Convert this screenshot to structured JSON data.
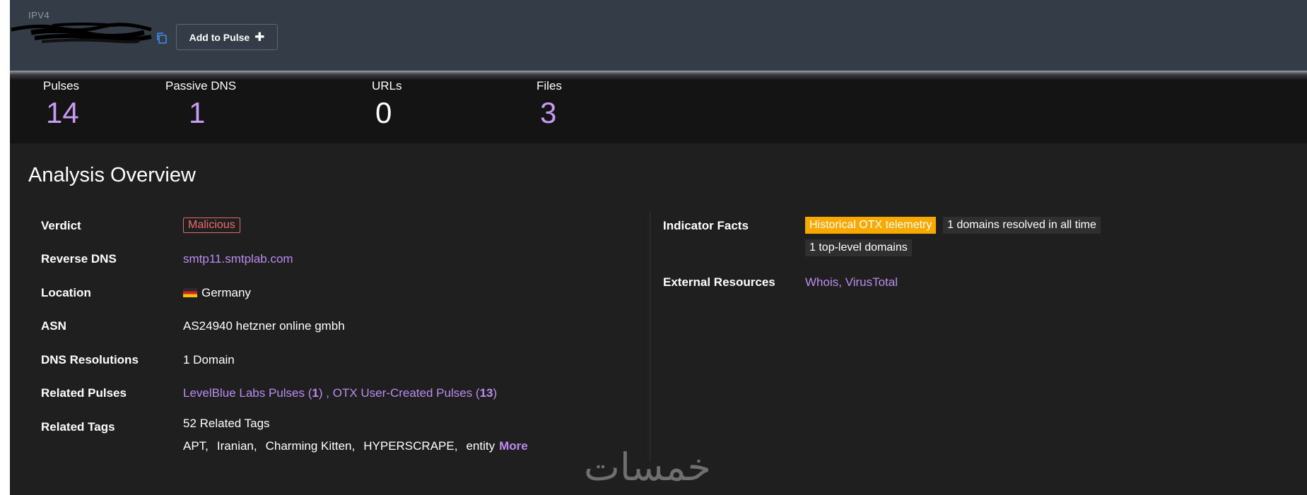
{
  "header": {
    "ip_type": "IPV4",
    "add_pulse_label": "Add to Pulse",
    "add_pulse_icon": "plus-icon",
    "copy_icon": "copy-icon"
  },
  "stats": [
    {
      "label": "Pulses",
      "value": "14"
    },
    {
      "label": "Passive DNS",
      "value": "1"
    },
    {
      "label": "URLs",
      "value": "0"
    },
    {
      "label": "Files",
      "value": "3"
    }
  ],
  "overview": {
    "title": "Analysis Overview",
    "left": {
      "verdict": {
        "label": "Verdict",
        "value": "Malicious"
      },
      "reverse_dns": {
        "label": "Reverse DNS",
        "value": "smtp11.smtplab.com"
      },
      "location": {
        "label": "Location",
        "value": "Germany"
      },
      "asn": {
        "label": "ASN",
        "value": "AS24940 hetzner online gmbh"
      },
      "dns_resolutions": {
        "label": "DNS Resolutions",
        "value": "1 Domain"
      },
      "related_pulses": {
        "label": "Related Pulses",
        "items": [
          {
            "name": "LevelBlue Labs Pulses",
            "open": " (",
            "count": "1",
            "close": ")"
          },
          {
            "sep": " , ",
            "name": "OTX User-Created Pulses",
            "open": " (",
            "count": "13",
            "close": ")"
          }
        ]
      },
      "related_tags": {
        "label": "Related Tags",
        "summary": "52 Related Tags",
        "tags": [
          "APT,",
          "Iranian,",
          "Charming Kitten,",
          "HYPERSCRAPE,",
          "entity"
        ],
        "more_label": "More"
      }
    },
    "right": {
      "indicator_facts": {
        "label": "Indicator Facts",
        "facts": [
          "Historical OTX telemetry",
          "1 domains resolved in all time",
          "1 top-level domains"
        ]
      },
      "external_resources": {
        "label": "External Resources",
        "links": [
          "Whois,",
          "VirusTotal"
        ]
      }
    }
  },
  "colors": {
    "accent": "#bb8cf0",
    "malicious": "#ef6b6b",
    "highlight": "#f7a900",
    "header_bg": "#343c48"
  }
}
